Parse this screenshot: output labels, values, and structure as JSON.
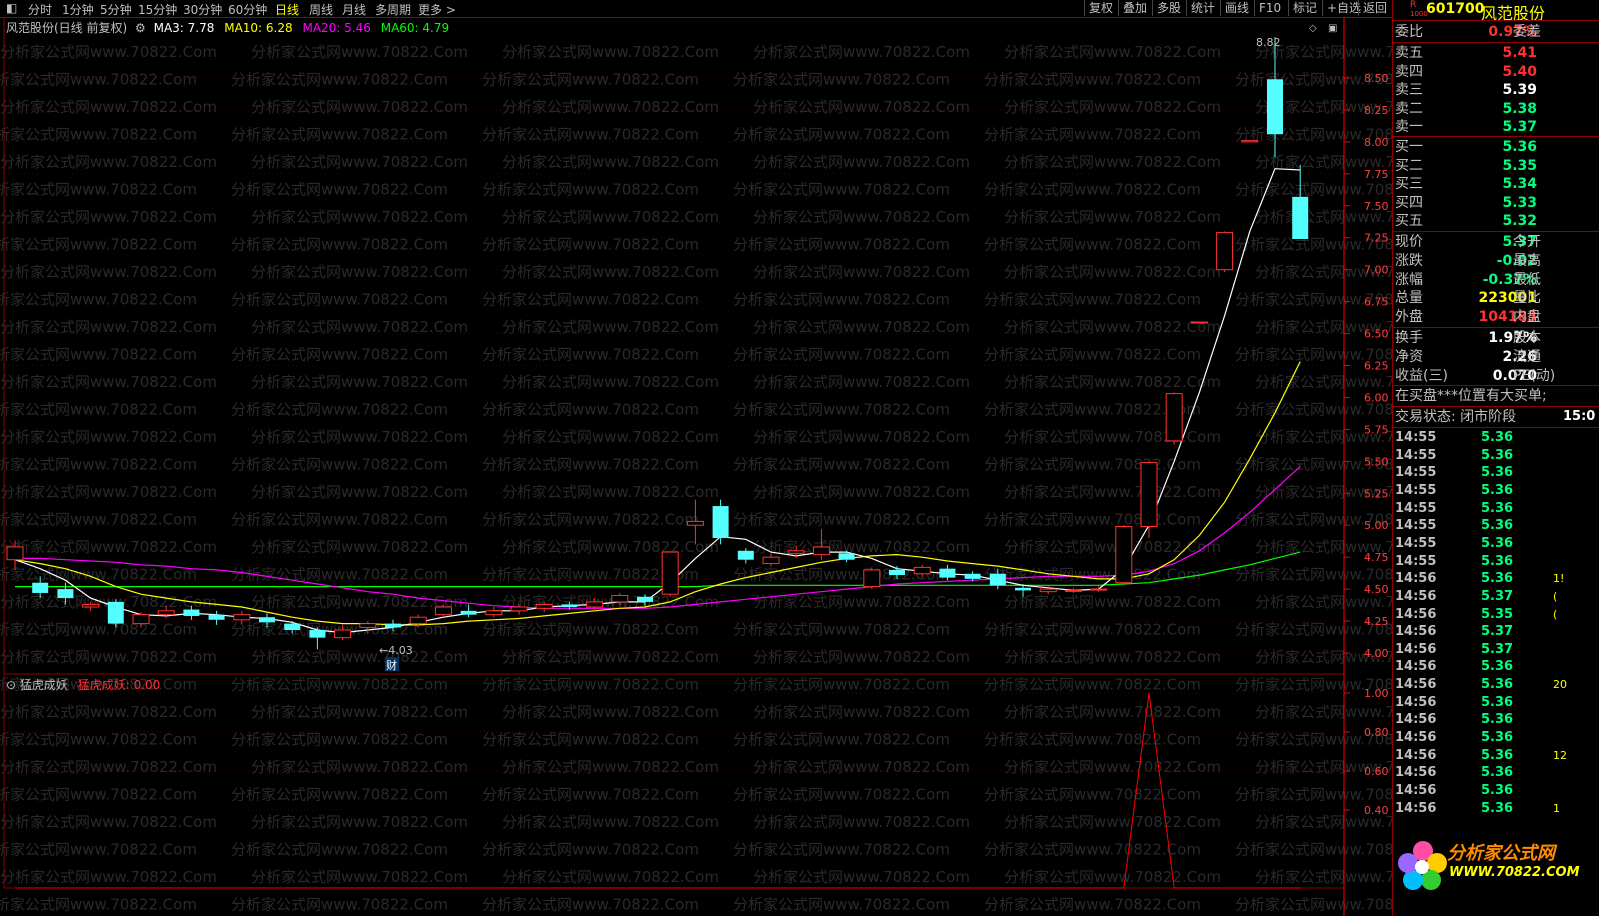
{
  "toolbar": {
    "left_items": [
      "分时",
      "1分钟",
      "5分钟",
      "15分钟",
      "30分钟",
      "60分钟",
      "日线",
      "周线",
      "月线",
      "多周期",
      "更多 >"
    ],
    "active_index": 6,
    "right_items": [
      "复权",
      "叠加",
      "多股",
      "统计",
      "画线",
      "F10",
      "标记",
      "+自选",
      "返回"
    ]
  },
  "chart": {
    "title": "风范股份(日线 前复权)",
    "ma_labels": [
      {
        "text": "MA3: 7.78",
        "color": "#ffffff"
      },
      {
        "text": "MA10: 6.28",
        "color": "#ffff00"
      },
      {
        "text": "MA20: 5.46",
        "color": "#ff00ff"
      },
      {
        "text": "MA60: 4.79",
        "color": "#00ff00"
      }
    ],
    "high_label": "8.82",
    "low_label": "4.03",
    "cai_label": "财",
    "price_axis": [
      "8.50",
      "8.25",
      "8.00",
      "7.75",
      "7.50",
      "7.25",
      "7.00",
      "6.75",
      "6.50",
      "6.25",
      "6.00",
      "5.75",
      "5.50",
      "5.25",
      "5.00",
      "4.75",
      "4.50",
      "4.25",
      "4.00"
    ],
    "indicator_title": "猛虎成妖",
    "indicator_value": "猛虎成妖: 0.00",
    "indicator_axis": [
      "1.00",
      "0.80",
      "0.60",
      "0.40"
    ],
    "watermark": "分析家公式网www.70822.Com",
    "candles": [
      [
        4.73,
        4.83,
        4.65,
        4.88
      ],
      [
        4.55,
        4.47,
        4.43,
        4.6
      ],
      [
        4.5,
        4.43,
        4.38,
        4.55
      ],
      [
        4.36,
        4.38,
        4.33,
        4.4
      ],
      [
        4.4,
        4.23,
        4.2,
        4.42
      ],
      [
        4.23,
        4.3,
        4.2,
        4.32
      ],
      [
        4.3,
        4.33,
        4.27,
        4.37
      ],
      [
        4.34,
        4.29,
        4.26,
        4.37
      ],
      [
        4.3,
        4.26,
        4.22,
        4.33
      ],
      [
        4.26,
        4.3,
        4.23,
        4.33
      ],
      [
        4.28,
        4.24,
        4.2,
        4.31
      ],
      [
        4.23,
        4.18,
        4.15,
        4.25
      ],
      [
        4.18,
        4.12,
        4.03,
        4.2
      ],
      [
        4.12,
        4.18,
        4.1,
        4.22
      ],
      [
        4.2,
        4.23,
        4.15,
        4.25
      ],
      [
        4.23,
        4.2,
        4.17,
        4.26
      ],
      [
        4.23,
        4.28,
        4.2,
        4.3
      ],
      [
        4.3,
        4.36,
        4.28,
        4.38
      ],
      [
        4.33,
        4.3,
        4.28,
        4.38
      ],
      [
        4.3,
        4.33,
        4.28,
        4.36
      ],
      [
        4.33,
        4.36,
        4.3,
        4.38
      ],
      [
        4.35,
        4.38,
        4.32,
        4.4
      ],
      [
        4.38,
        4.36,
        4.34,
        4.4
      ],
      [
        4.36,
        4.4,
        4.33,
        4.43
      ],
      [
        4.4,
        4.45,
        4.38,
        4.47
      ],
      [
        4.44,
        4.4,
        4.37,
        4.46
      ],
      [
        4.46,
        4.79,
        4.44,
        4.8
      ],
      [
        5.0,
        5.03,
        4.85,
        5.2
      ],
      [
        5.15,
        4.9,
        4.85,
        5.2
      ],
      [
        4.8,
        4.73,
        4.7,
        4.82
      ],
      [
        4.7,
        4.75,
        4.68,
        4.78
      ],
      [
        4.78,
        4.8,
        4.74,
        4.84
      ],
      [
        4.77,
        4.83,
        4.73,
        4.97
      ],
      [
        4.78,
        4.73,
        4.71,
        4.8
      ],
      [
        4.52,
        4.65,
        4.5,
        4.67
      ],
      [
        4.65,
        4.61,
        4.58,
        4.68
      ],
      [
        4.62,
        4.67,
        4.59,
        4.69
      ],
      [
        4.66,
        4.59,
        4.57,
        4.69
      ],
      [
        4.62,
        4.58,
        4.56,
        4.64
      ],
      [
        4.62,
        4.53,
        4.5,
        4.66
      ],
      [
        4.51,
        4.49,
        4.44,
        4.54
      ],
      [
        4.48,
        4.5,
        4.46,
        4.53
      ],
      [
        4.49,
        4.49,
        4.47,
        4.51
      ],
      [
        4.5,
        4.5,
        4.48,
        4.52
      ],
      [
        4.55,
        4.99,
        4.53,
        5.0
      ],
      [
        4.99,
        5.49,
        4.9,
        5.5
      ],
      [
        5.66,
        6.03,
        5.63,
        6.04
      ],
      [
        6.59,
        6.59,
        6.59,
        6.59
      ],
      [
        7.0,
        7.29,
        6.98,
        7.3
      ],
      [
        8.0,
        8.01,
        8.0,
        8.01
      ],
      [
        8.49,
        8.06,
        7.88,
        8.82
      ],
      [
        7.57,
        7.24,
        7.24,
        7.82
      ]
    ],
    "ma3": [
      4.73,
      4.66,
      4.57,
      4.43,
      4.36,
      4.3,
      4.29,
      4.31,
      4.3,
      4.28,
      4.27,
      4.24,
      4.18,
      4.16,
      4.18,
      4.2,
      4.24,
      4.28,
      4.31,
      4.33,
      4.33,
      4.36,
      4.37,
      4.38,
      4.4,
      4.4,
      4.55,
      4.74,
      4.91,
      4.89,
      4.79,
      4.76,
      4.79,
      4.79,
      4.74,
      4.66,
      4.64,
      4.62,
      4.61,
      4.57,
      4.53,
      4.51,
      4.49,
      4.5,
      4.66,
      5.0,
      5.5,
      6.04,
      6.64,
      7.3,
      7.79,
      7.78
    ],
    "ma10": [
      4.73,
      4.7,
      4.66,
      4.6,
      4.52,
      4.46,
      4.43,
      4.4,
      4.38,
      4.36,
      4.32,
      4.28,
      4.25,
      4.23,
      4.23,
      4.22,
      4.22,
      4.23,
      4.25,
      4.26,
      4.27,
      4.29,
      4.31,
      4.33,
      4.35,
      4.36,
      4.4,
      4.48,
      4.54,
      4.59,
      4.63,
      4.67,
      4.71,
      4.74,
      4.76,
      4.77,
      4.75,
      4.72,
      4.7,
      4.68,
      4.65,
      4.62,
      4.6,
      4.58,
      4.58,
      4.62,
      4.73,
      4.92,
      5.18,
      5.52,
      5.88,
      6.28
    ],
    "ma20": [
      4.74,
      4.74,
      4.73,
      4.72,
      4.71,
      4.69,
      4.68,
      4.66,
      4.65,
      4.63,
      4.6,
      4.57,
      4.54,
      4.51,
      4.48,
      4.46,
      4.43,
      4.41,
      4.39,
      4.37,
      4.36,
      4.35,
      4.35,
      4.35,
      4.35,
      4.35,
      4.36,
      4.38,
      4.4,
      4.42,
      4.44,
      4.46,
      4.48,
      4.5,
      4.52,
      4.54,
      4.55,
      4.56,
      4.57,
      4.58,
      4.59,
      4.6,
      4.6,
      4.6,
      4.61,
      4.64,
      4.7,
      4.8,
      4.94,
      5.1,
      5.28,
      5.46
    ],
    "ma60": [
      4.52,
      4.52,
      4.52,
      4.52,
      4.52,
      4.52,
      4.52,
      4.52,
      4.52,
      4.52,
      4.52,
      4.52,
      4.52,
      4.52,
      4.52,
      4.52,
      4.52,
      4.52,
      4.52,
      4.52,
      4.52,
      4.52,
      4.52,
      4.52,
      4.52,
      4.52,
      4.52,
      4.52,
      4.53,
      4.53,
      4.53,
      4.53,
      4.53,
      4.53,
      4.53,
      4.53,
      4.53,
      4.53,
      4.53,
      4.53,
      4.53,
      4.53,
      4.53,
      4.53,
      4.54,
      4.55,
      4.58,
      4.61,
      4.65,
      4.69,
      4.74,
      4.79
    ],
    "indicator": [
      0,
      0,
      0,
      0,
      0,
      0,
      0,
      0,
      0,
      0,
      0,
      0,
      0,
      0,
      0,
      0,
      0,
      0,
      0,
      0,
      0,
      0,
      0,
      0,
      0,
      0,
      0,
      0,
      0,
      0,
      0,
      0,
      0,
      0,
      0,
      0,
      0,
      0,
      0,
      0,
      0,
      0,
      0,
      0,
      0,
      1,
      0,
      0,
      0,
      0,
      0,
      0
    ]
  },
  "panel": {
    "badge": "R",
    "badge_sub": "1000",
    "code": "601700",
    "name": "风范股份",
    "weibi_label": "委比",
    "weibi_value": "0.97%",
    "weicha_label": "委差",
    "asks": [
      {
        "label": "卖五",
        "price": "5.41",
        "color": "#ff3030"
      },
      {
        "label": "卖四",
        "price": "5.40",
        "color": "#ff3030"
      },
      {
        "label": "卖三",
        "price": "5.39",
        "color": "#ffffff"
      },
      {
        "label": "卖二",
        "price": "5.38",
        "color": "#00ff7f"
      },
      {
        "label": "卖一",
        "price": "5.37",
        "color": "#00ff7f"
      }
    ],
    "bids": [
      {
        "label": "买一",
        "price": "5.36",
        "color": "#00ff7f"
      },
      {
        "label": "买二",
        "price": "5.35",
        "color": "#00ff7f"
      },
      {
        "label": "买三",
        "price": "5.34",
        "color": "#00ff7f"
      },
      {
        "label": "买四",
        "price": "5.33",
        "color": "#00ff7f"
      },
      {
        "label": "买五",
        "price": "5.32",
        "color": "#00ff7f"
      }
    ],
    "quote": [
      {
        "label": "现价",
        "value": "5.37",
        "color": "#00ff7f",
        "extra": "今开"
      },
      {
        "label": "涨跌",
        "value": "-0.02",
        "color": "#00ff7f",
        "extra": "最高"
      },
      {
        "label": "涨幅",
        "value": "-0.37%",
        "color": "#00ff7f",
        "extra": "最低"
      },
      {
        "label": "总量",
        "value": "223001",
        "color": "#ffff00",
        "extra": "量比"
      },
      {
        "label": "外盘",
        "value": "104183",
        "color": "#ff3030",
        "extra": "内盘"
      }
    ],
    "fund": [
      {
        "label": "换手",
        "value": "1.97%",
        "extra": "股本"
      },
      {
        "label": "净资",
        "value": "2.26",
        "extra": "流通"
      },
      {
        "label": "收益(三)",
        "value": "0.070",
        "extra": "PE(动)"
      }
    ],
    "notice": "在买盘***位置有大买单;",
    "status_label": "交易状态: 闭市阶段",
    "status_time": "15:0",
    "ticks": [
      {
        "time": "14:55",
        "price": "5.36",
        "vol": ""
      },
      {
        "time": "14:55",
        "price": "5.36",
        "vol": ""
      },
      {
        "time": "14:55",
        "price": "5.36",
        "vol": ""
      },
      {
        "time": "14:55",
        "price": "5.36",
        "vol": ""
      },
      {
        "time": "14:55",
        "price": "5.36",
        "vol": ""
      },
      {
        "time": "14:55",
        "price": "5.36",
        "vol": ""
      },
      {
        "time": "14:55",
        "price": "5.36",
        "vol": ""
      },
      {
        "time": "14:55",
        "price": "5.36",
        "vol": ""
      },
      {
        "time": "14:56",
        "price": "5.36",
        "vol": "1!"
      },
      {
        "time": "14:56",
        "price": "5.37",
        "vol": "("
      },
      {
        "time": "14:56",
        "price": "5.35",
        "vol": "("
      },
      {
        "time": "14:56",
        "price": "5.37",
        "vol": ""
      },
      {
        "time": "14:56",
        "price": "5.37",
        "vol": ""
      },
      {
        "time": "14:56",
        "price": "5.36",
        "vol": ""
      },
      {
        "time": "14:56",
        "price": "5.36",
        "vol": "20"
      },
      {
        "time": "14:56",
        "price": "5.36",
        "vol": ""
      },
      {
        "time": "14:56",
        "price": "5.36",
        "vol": ""
      },
      {
        "time": "14:56",
        "price": "5.36",
        "vol": ""
      },
      {
        "time": "14:56",
        "price": "5.36",
        "vol": "12"
      },
      {
        "time": "14:56",
        "price": "5.36",
        "vol": ""
      },
      {
        "time": "14:56",
        "price": "5.36",
        "vol": ""
      },
      {
        "time": "14:56",
        "price": "5.36",
        "vol": "1"
      }
    ],
    "logo_text": "分析家公式网",
    "logo_url": "WWW.70822.COM"
  }
}
